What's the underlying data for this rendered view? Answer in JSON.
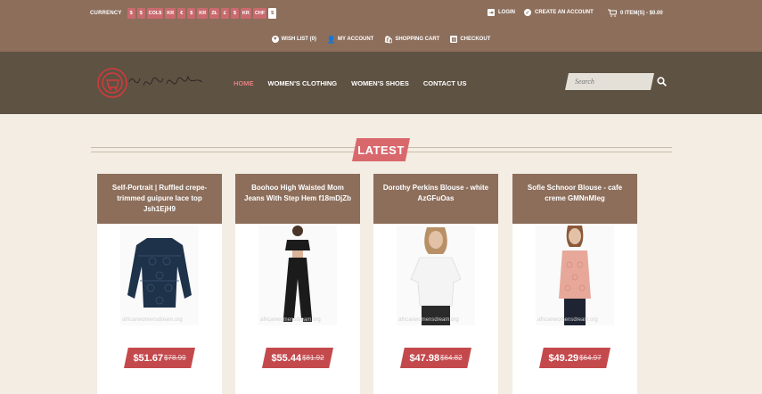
{
  "topbar": {
    "currency_label": "CURRENCY",
    "currencies": [
      "$",
      "$",
      "COL$",
      "KR",
      "€",
      "$",
      "KR",
      "ZŁ",
      "£",
      "$",
      "KR",
      "CHF",
      "$"
    ],
    "login": "LOGIN",
    "create_account": "CREATE AN ACCOUNT",
    "cart_summary": "0 ITEM(S) - $0.00",
    "wishlist": "WISH LIST (0)",
    "my_account": "MY ACCOUNT",
    "shopping_cart": "SHOPPING CART",
    "checkout": "CHECKOUT"
  },
  "header": {
    "logo_text": "BuyMyWay",
    "nav": [
      "HOME",
      "WOMEN'S CLOTHING",
      "WOMEN'S SHOES",
      "CONTACT US"
    ],
    "search_placeholder": "Search"
  },
  "section": {
    "title": "LATEST"
  },
  "products": [
    {
      "title": "Self-Portrait | Ruffled crepe-trimmed guipure lace top Jsh1EjH9",
      "price": "$51.67",
      "old_price": "$78.99",
      "watermark": "africanwomensdream.org",
      "color": "#1e3249"
    },
    {
      "title": "Boohoo High Waisted Mom Jeans With Step Hem f18mDjZb",
      "price": "$55.44",
      "old_price": "$81.92",
      "watermark": "africanwomensdream.org",
      "color": "#1b1b1b"
    },
    {
      "title": "Dorothy Perkins Blouse - white AzGFuOas",
      "price": "$47.98",
      "old_price": "$64.82",
      "watermark": "africanwomensdream.org",
      "color": "#f1f1f1"
    },
    {
      "title": "Sofie Schnoor Blouse - cafe creme GMNnMleg",
      "price": "$49.29",
      "old_price": "$64.97",
      "watermark": "africanwomensdream.org",
      "color": "#e7a89a"
    }
  ]
}
